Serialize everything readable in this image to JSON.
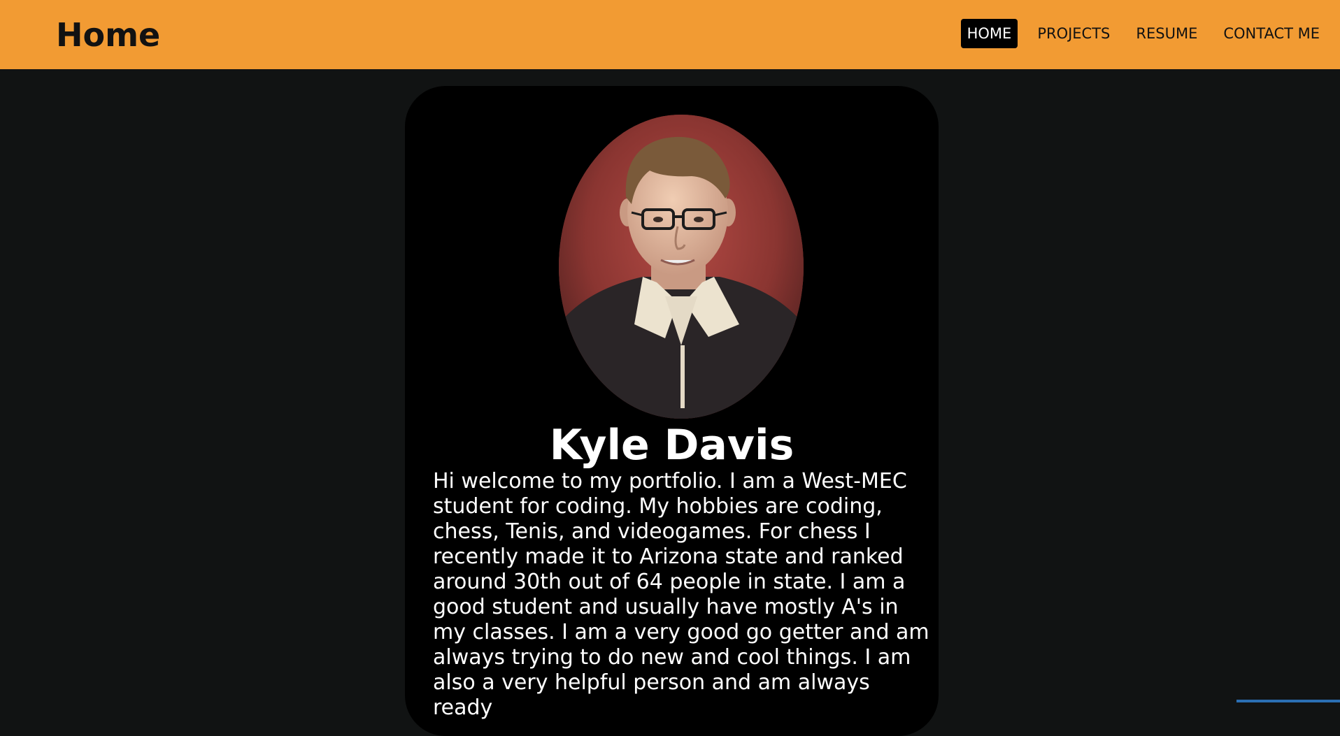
{
  "header": {
    "title": "Home",
    "nav": [
      {
        "label": "HOME",
        "active": true
      },
      {
        "label": "PROJECTS",
        "active": false
      },
      {
        "label": "RESUME",
        "active": false
      },
      {
        "label": "CONTACT ME",
        "active": false
      }
    ]
  },
  "profile": {
    "name": "Kyle Davis",
    "bio": "Hi welcome to my portfolio. I am a West-MEC student for coding. My hobbies are coding, chess, Tenis, and videogames. For chess I recently made it to Arizona state and ranked around 30th out of 64 people in state. I am a good student and usually have mostly A's in my classes. I am a very good go getter and am always trying to do new and cool things. I am also a very helpful person and am always ready"
  },
  "colors": {
    "header_bg": "#f29b33",
    "page_bg": "#111313",
    "card_bg": "#000000",
    "active_nav_bg": "#000000",
    "accent": "#2b6fb3"
  }
}
